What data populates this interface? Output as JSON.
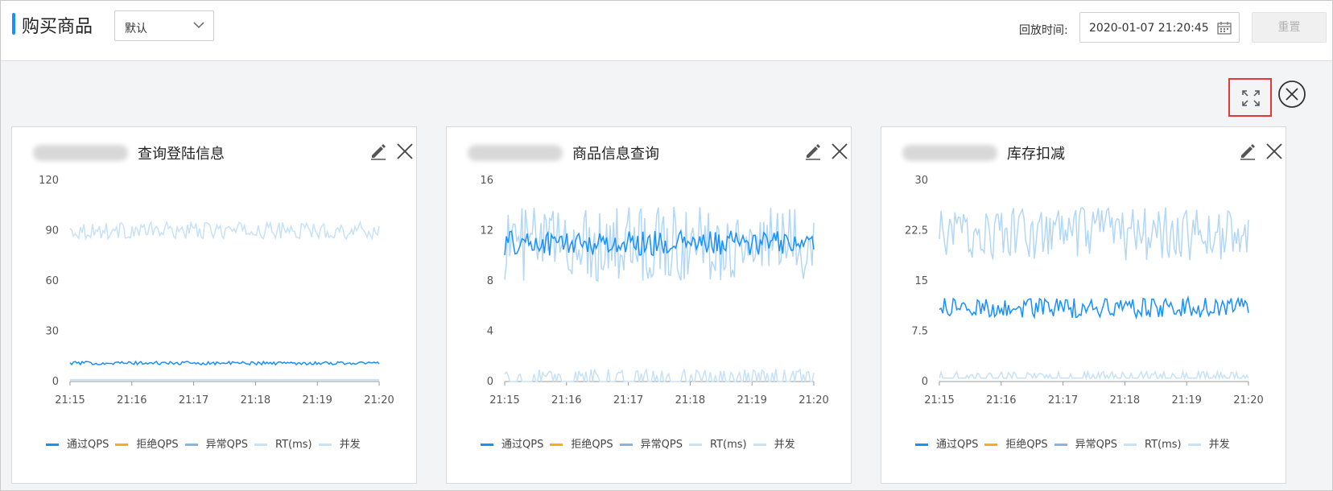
{
  "header": {
    "title": "购买商品",
    "select_value": "默认",
    "replay_label": "回放时间:",
    "replay_time": "2020-01-07 21:20:45",
    "reset_label": "重置"
  },
  "legend": [
    {
      "label": "通过QPS",
      "color": "#1890ff"
    },
    {
      "label": "拒绝QPS",
      "color": "#faad14"
    },
    {
      "label": "异常QPS",
      "color": "#8ab4e0"
    },
    {
      "label": "RT(ms)",
      "color": "#c7e2f8"
    },
    {
      "label": "并发",
      "color": "#c7e2f8"
    }
  ],
  "cards": [
    {
      "title": "查询登陆信息"
    },
    {
      "title": "商品信息查询"
    },
    {
      "title": "库存扣减"
    }
  ],
  "chart_data": [
    {
      "type": "line",
      "title": "查询登陆信息",
      "x_ticks": [
        "21:15",
        "21:16",
        "21:17",
        "21:18",
        "21:19",
        "21:20"
      ],
      "y_ticks": [
        "0",
        "30",
        "60",
        "90",
        "120"
      ],
      "ylim": [
        0,
        120
      ],
      "grid": false,
      "legend_position": "bottom",
      "series": [
        {
          "name": "RT(ms)",
          "color": "#c7e2f8",
          "center": 90,
          "spread": 5,
          "pattern": "continuous"
        },
        {
          "name": "通过QPS",
          "color": "#1890ff",
          "center": 11,
          "spread": 1,
          "pattern": "continuous"
        },
        {
          "name": "并发",
          "color": "#c7e2f8",
          "center": 1,
          "spread": 0,
          "pattern": "flat"
        }
      ]
    },
    {
      "type": "line",
      "title": "商品信息查询",
      "x_ticks": [
        "21:15",
        "21:16",
        "21:17",
        "21:18",
        "21:19",
        "21:20"
      ],
      "y_ticks": [
        "0",
        "4",
        "8",
        "12",
        "16"
      ],
      "ylim": [
        0,
        16
      ],
      "grid": false,
      "legend_position": "bottom",
      "series": [
        {
          "name": "RT(ms)",
          "color": "#b3d7f7",
          "center": 11,
          "spread": 3,
          "pattern": "continuous"
        },
        {
          "name": "通过QPS",
          "color": "#1890ff",
          "center": 11,
          "spread": 1,
          "pattern": "continuous"
        },
        {
          "name": "并发",
          "color": "#c7e2f8",
          "center": 0,
          "spread": 1,
          "pattern": "spikes"
        }
      ]
    },
    {
      "type": "line",
      "title": "库存扣减",
      "x_ticks": [
        "21:15",
        "21:16",
        "21:17",
        "21:18",
        "21:19",
        "21:20"
      ],
      "y_ticks": [
        "0",
        "7.5",
        "15",
        "22.5",
        "30"
      ],
      "ylim": [
        0,
        30
      ],
      "grid": false,
      "legend_position": "bottom",
      "series": [
        {
          "name": "RT(ms)",
          "color": "#b3d7f7",
          "center": 22,
          "spread": 4,
          "pattern": "continuous"
        },
        {
          "name": "通过QPS",
          "color": "#1890ff",
          "center": 11,
          "spread": 1.5,
          "pattern": "continuous"
        },
        {
          "name": "并发",
          "color": "#c7e2f8",
          "center": 0.5,
          "spread": 1,
          "pattern": "spikes"
        }
      ]
    }
  ]
}
